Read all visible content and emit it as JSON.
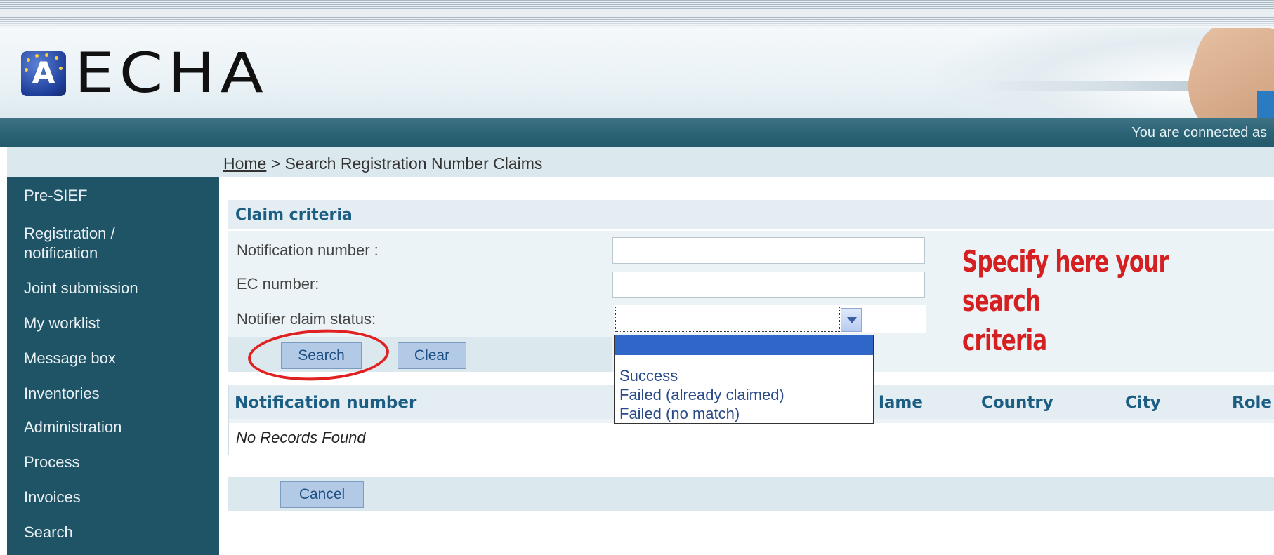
{
  "header": {
    "logo_text": "ECHA",
    "connection_text": "You are connected as"
  },
  "breadcrumb": {
    "home": "Home",
    "separator": " > ",
    "current": "Search Registration Number Claims"
  },
  "sidebar": {
    "items": [
      {
        "label": "Pre-SIEF"
      },
      {
        "label": "Registration /"
      },
      {
        "label": "notification"
      },
      {
        "label": "Joint submission"
      },
      {
        "label": "My worklist"
      },
      {
        "label": "Message box"
      },
      {
        "label": "Inventories"
      },
      {
        "label": "Administration"
      },
      {
        "label": "Process"
      },
      {
        "label": "Invoices"
      },
      {
        "label": "Search"
      }
    ]
  },
  "claim_criteria": {
    "title": "Claim criteria",
    "notification_number_label": "Notification number :",
    "notification_number_value": "",
    "ec_number_label": "EC number:",
    "ec_number_value": "",
    "status_label": "Notifier claim status:",
    "status_value": "",
    "status_options": [
      "",
      "Success",
      "Failed (already claimed)",
      "Failed (no match)"
    ],
    "search_button": "Search",
    "clear_button": "Clear"
  },
  "annotation": {
    "line1": "Specify here your search",
    "line2": "criteria",
    "color": "#d42020"
  },
  "results": {
    "columns": [
      "Notification number",
      "Name",
      "Country",
      "City",
      "Role"
    ],
    "column_display": [
      "Notification number",
      "lame",
      "Country",
      "City",
      "Role"
    ],
    "empty_message": "No Records Found"
  },
  "footer": {
    "cancel_button": "Cancel"
  },
  "colors": {
    "sidebar_bg": "#1f5366",
    "topbar_bg": "#2c6475",
    "heading_text": "#1c5d84",
    "button_bg": "#b3cae6"
  }
}
